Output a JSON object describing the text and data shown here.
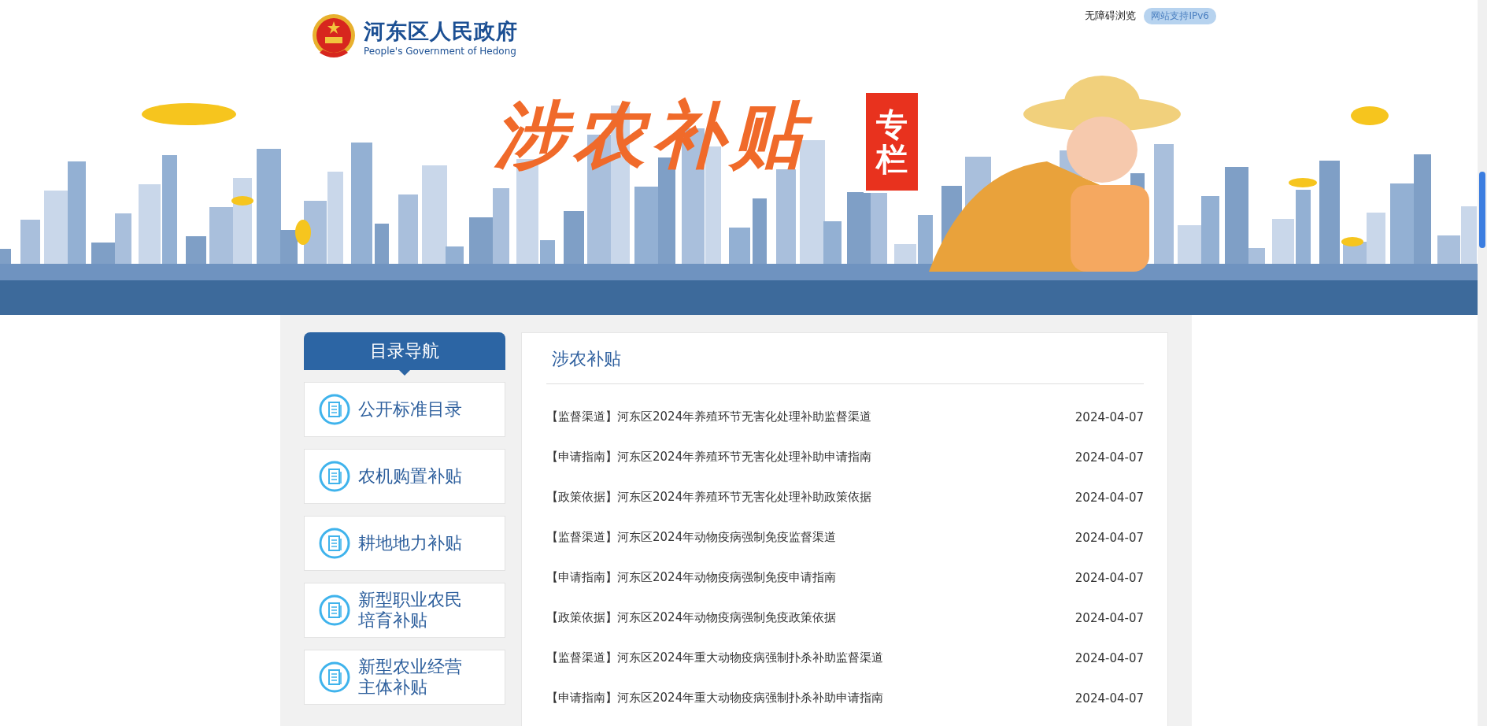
{
  "header": {
    "site_title": "河东区人民政府",
    "site_subtitle": "People's Government of Hedong",
    "links": [
      {
        "label": "无障碍浏览",
        "kind": "link"
      },
      {
        "label": "网站支持IPv6",
        "kind": "badge"
      }
    ]
  },
  "banner": {
    "title": "涉农补贴",
    "badge": "专栏"
  },
  "sidebar": {
    "heading": "目录导航",
    "items": [
      {
        "label": "公开标准目录"
      },
      {
        "label": "农机购置补贴"
      },
      {
        "label": "耕地地力补贴"
      },
      {
        "label": "新型职业农民培育补贴"
      },
      {
        "label": "新型农业经营主体补贴"
      }
    ]
  },
  "content": {
    "title": "涉农补贴",
    "articles": [
      {
        "title": "【监督渠道】河东区2024年养殖环节无害化处理补助监督渠道",
        "date": "2024-04-07"
      },
      {
        "title": "【申请指南】河东区2024年养殖环节无害化处理补助申请指南",
        "date": "2024-04-07"
      },
      {
        "title": "【政策依据】河东区2024年养殖环节无害化处理补助政策依据",
        "date": "2024-04-07"
      },
      {
        "title": "【监督渠道】河东区2024年动物疫病强制免疫监督渠道",
        "date": "2024-04-07"
      },
      {
        "title": "【申请指南】河东区2024年动物疫病强制免疫申请指南",
        "date": "2024-04-07"
      },
      {
        "title": "【政策依据】河东区2024年动物疫病强制免疫政策依据",
        "date": "2024-04-07"
      },
      {
        "title": "【监督渠道】河东区2024年重大动物疫病强制扑杀补助监督渠道",
        "date": "2024-04-07"
      },
      {
        "title": "【申请指南】河东区2024年重大动物疫病强制扑杀补助申请指南",
        "date": "2024-04-07"
      }
    ]
  }
}
